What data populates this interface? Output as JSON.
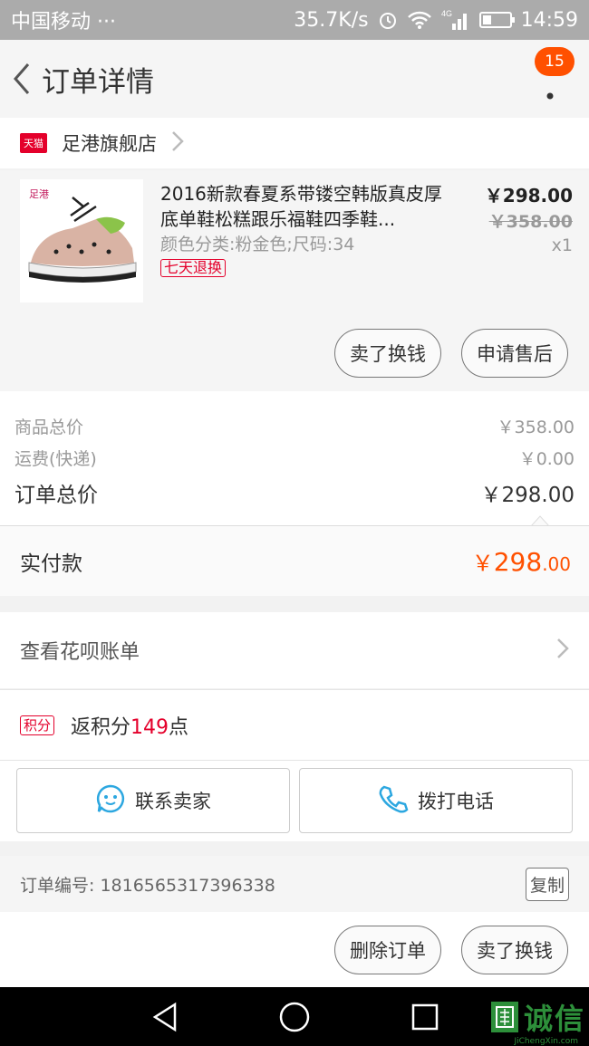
{
  "statusbar": {
    "carrier": "中国移动 ···",
    "net_speed": "35.7K/s",
    "signal_label": "4G",
    "time": "14:59"
  },
  "header": {
    "title": "订单详情",
    "badge_count": "15"
  },
  "shop": {
    "logo_text": "天猫",
    "name": "足港旗舰店"
  },
  "product": {
    "title": "2016新款春夏系带镂空韩版真皮厚底单鞋松糕跟乐福鞋四季鞋...",
    "sku": "颜色分类:粉金色;尺码:34",
    "tag": "七天退换",
    "price": "￥298.00",
    "original_price": "￥358.00",
    "quantity": "x1",
    "brand_logo": "足港",
    "sell_button": "卖了换钱",
    "after_sale_button": "申请售后"
  },
  "summary": {
    "goods_total_label": "商品总价",
    "goods_total_value": "￥358.00",
    "shipping_label": "运费(快递)",
    "shipping_value": "￥0.00",
    "order_total_label": "订单总价",
    "order_total_value": "￥298.00",
    "paid_label": "实付款",
    "paid_currency": "￥",
    "paid_int": "298",
    "paid_dec": ".00"
  },
  "huabei": {
    "label": "查看花呗账单"
  },
  "points": {
    "tag": "积分",
    "prefix": "返积分",
    "count": "149",
    "suffix": "点"
  },
  "contact": {
    "seller_label": "联系卖家",
    "call_label": "拨打电话"
  },
  "order": {
    "number_label": "订单编号: 1816565317396338",
    "copy_label": "复制"
  },
  "actions": {
    "delete_label": "删除订单",
    "sell_label": "卖了换钱"
  },
  "watermark": {
    "text": "诚信",
    "sub": "JiChengXin.com"
  },
  "colors": {
    "accent": "#ff5000",
    "tmall_red": "#e4002b",
    "icon_blue": "#2ca7e0"
  }
}
